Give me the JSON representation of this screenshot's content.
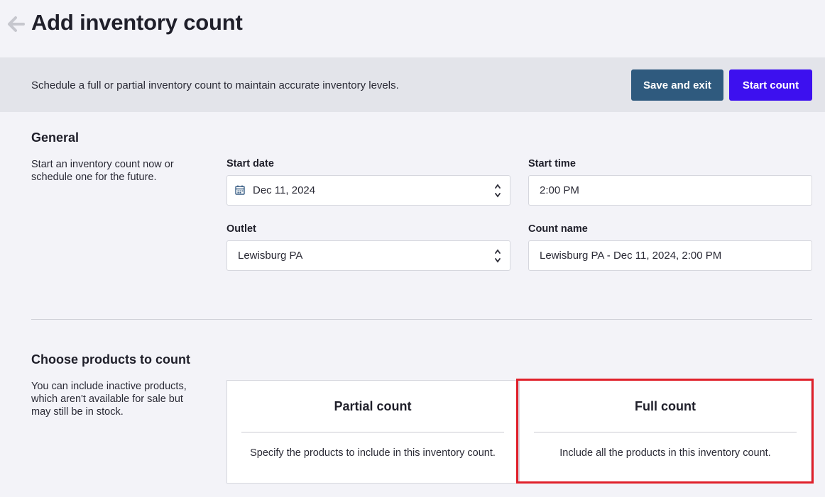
{
  "header": {
    "title": "Add inventory count",
    "back_icon": "arrow-left-icon"
  },
  "banner": {
    "description": "Schedule a full or partial inventory count to maintain accurate inventory levels.",
    "save_exit_label": "Save and exit",
    "start_count_label": "Start count"
  },
  "general": {
    "title": "General",
    "description": "Start an inventory count now or schedule one for the future.",
    "start_date": {
      "label": "Start date",
      "value": "Dec 11, 2024",
      "icon": "calendar-icon"
    },
    "start_time": {
      "label": "Start time",
      "value": "2:00 PM"
    },
    "outlet": {
      "label": "Outlet",
      "value": "Lewisburg PA"
    },
    "count_name": {
      "label": "Count name",
      "value": "Lewisburg PA - Dec 11, 2024, 2:00 PM"
    }
  },
  "products": {
    "title": "Choose products to count",
    "description": "You can include inactive products, which aren't available for sale but may still be in stock.",
    "options": [
      {
        "title": "Partial count",
        "description": "Specify the products to include in this inventory count."
      },
      {
        "title": "Full count",
        "description": "Include all the products in this inventory count."
      }
    ]
  },
  "colors": {
    "save_button": "#2f5a7e",
    "start_button": "#3d10ef",
    "highlight": "#e0202a"
  }
}
